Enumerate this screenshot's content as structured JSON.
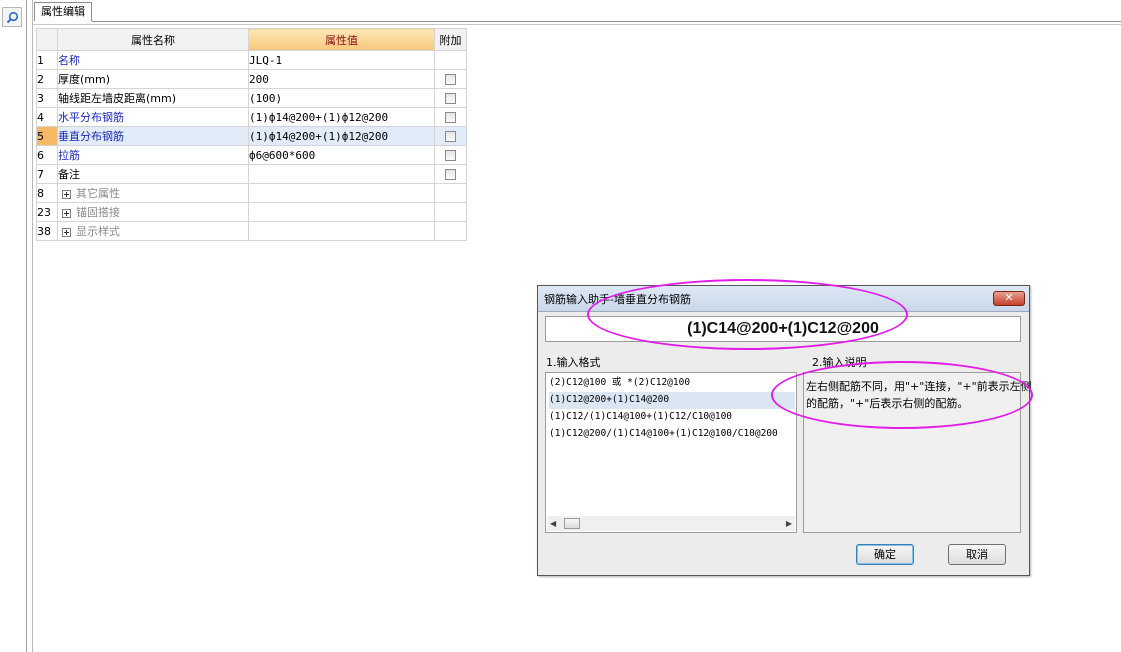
{
  "sidebar": {
    "search_icon": "search-icon"
  },
  "tab": {
    "label": "属性编辑"
  },
  "table": {
    "headers": {
      "name": "属性名称",
      "value": "属性值",
      "add": "附加"
    },
    "rows": [
      {
        "num": "1",
        "name": "名称",
        "value": "JLQ-1",
        "has_checkbox": false
      },
      {
        "num": "2",
        "name": "厚度(mm)",
        "value": "200",
        "has_checkbox": true
      },
      {
        "num": "3",
        "name": "轴线距左墙皮距离(mm)",
        "value": "(100)",
        "has_checkbox": true
      },
      {
        "num": "4",
        "name": "水平分布钢筋",
        "value": "(1)ф14@200+(1)ф12@200",
        "has_checkbox": true
      },
      {
        "num": "5",
        "name": "垂直分布钢筋",
        "value": "(1)ф14@200+(1)ф12@200",
        "has_checkbox": true
      },
      {
        "num": "6",
        "name": "拉筋",
        "value": "ф6@600*600",
        "has_checkbox": true
      },
      {
        "num": "7",
        "name": "备注",
        "value": "",
        "has_checkbox": true
      },
      {
        "num": "8",
        "name": "其它属性",
        "value": "",
        "has_checkbox": false
      },
      {
        "num": "23",
        "name": "锚固搭接",
        "value": "",
        "has_checkbox": false
      },
      {
        "num": "38",
        "name": "显示样式",
        "value": "",
        "has_checkbox": false
      }
    ]
  },
  "dialog": {
    "title": "钢筋输入助手-墙垂直分布钢筋",
    "close_label": "✕",
    "result": "(1)C14@200+(1)C12@200",
    "format_label": "1.输入格式",
    "desc_label": "2.输入说明",
    "formats": [
      "(2)C12@100 或 *(2)C12@100",
      "(1)C12@200+(1)C14@200",
      "(1)C12/(1)C14@100+(1)C12/C10@100",
      "(1)C12@200/(1)C14@100+(1)C12@100/C10@200"
    ],
    "description": "左右侧配筋不同，用\"+\"连接，\"+\"前表示左侧的配筋，\"+\"后表示右侧的配筋。",
    "ok_label": "确定",
    "cancel_label": "取消"
  },
  "colors": {
    "annotation": "#e21ce8",
    "link": "#1b27b5",
    "selected_row": "#e1ecf8"
  }
}
